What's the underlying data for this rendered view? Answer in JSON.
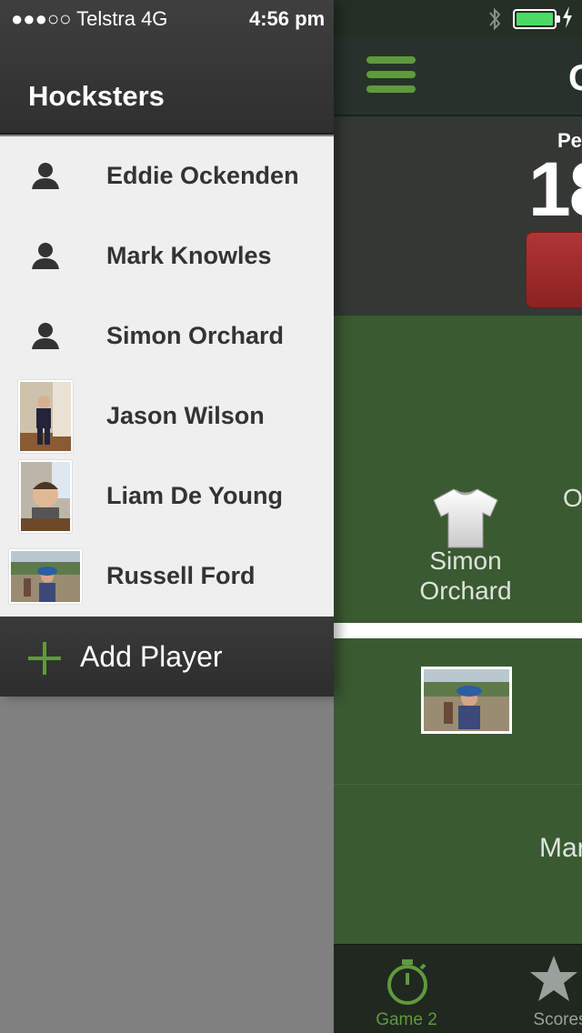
{
  "status_bar": {
    "carrier_text": "●●●○○ Telstra   4G",
    "time": "4:56 pm"
  },
  "drawer": {
    "title": "Hocksters",
    "players": [
      {
        "name": "Eddie Ockenden",
        "avatar": "person-icon"
      },
      {
        "name": "Mark Knowles",
        "avatar": "person-icon"
      },
      {
        "name": "Simon Orchard",
        "avatar": "person-icon"
      },
      {
        "name": "Jason Wilson",
        "avatar": "photo"
      },
      {
        "name": "Liam De Young",
        "avatar": "photo"
      },
      {
        "name": "Russell Ford",
        "avatar": "photo"
      }
    ],
    "add_player_label": "Add Player"
  },
  "main": {
    "title_partial": "G",
    "period_label_partial": "Pe",
    "score_partial": "18",
    "field_player_name": "Simon Orchard",
    "field_letter_partial": "O",
    "field_name_partial": "Mar"
  },
  "tabs": [
    {
      "label": "Game 2",
      "icon": "stopwatch-icon",
      "active": true
    },
    {
      "label": "Scores",
      "icon": "star-icon",
      "active": false
    }
  ],
  "colors": {
    "accent_green": "#5f9a3d",
    "field_green": "#3a5a32",
    "drawer_bg": "#efefef",
    "red_button": "#a02c2c",
    "battery_green": "#4cd964"
  }
}
